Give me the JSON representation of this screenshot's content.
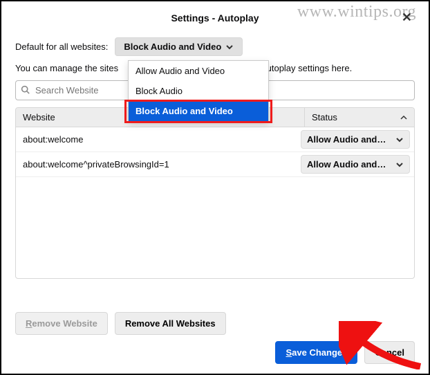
{
  "watermark": "www.wintips.org",
  "dialog": {
    "title": "Settings - Autoplay",
    "close_glyph": "✕",
    "default_label": "Default for all websites:",
    "default_button": "Block Audio and Video",
    "manage_prefix": "You can manage the sites",
    "manage_suffix": "autoplay settings here.",
    "dropdown": {
      "items": [
        {
          "label": "Allow Audio and Video",
          "selected": false
        },
        {
          "label": "Block Audio",
          "selected": false
        },
        {
          "label": "Block Audio and Video",
          "selected": true
        }
      ]
    },
    "search_placeholder": "Search Website",
    "table": {
      "col_website": "Website",
      "col_status": "Status",
      "rows": [
        {
          "website": "about:welcome",
          "status_label": "Allow Audio and…"
        },
        {
          "website": "about:welcome^privateBrowsingId=1",
          "status_label": "Allow Audio and…"
        }
      ]
    },
    "remove_website_label": "Remove Website",
    "remove_all_label": "Remove All Websites",
    "save_label": "Save Changes",
    "cancel_label": "Cancel",
    "remove_website_accesskey": "R",
    "save_accesskey": "S"
  }
}
